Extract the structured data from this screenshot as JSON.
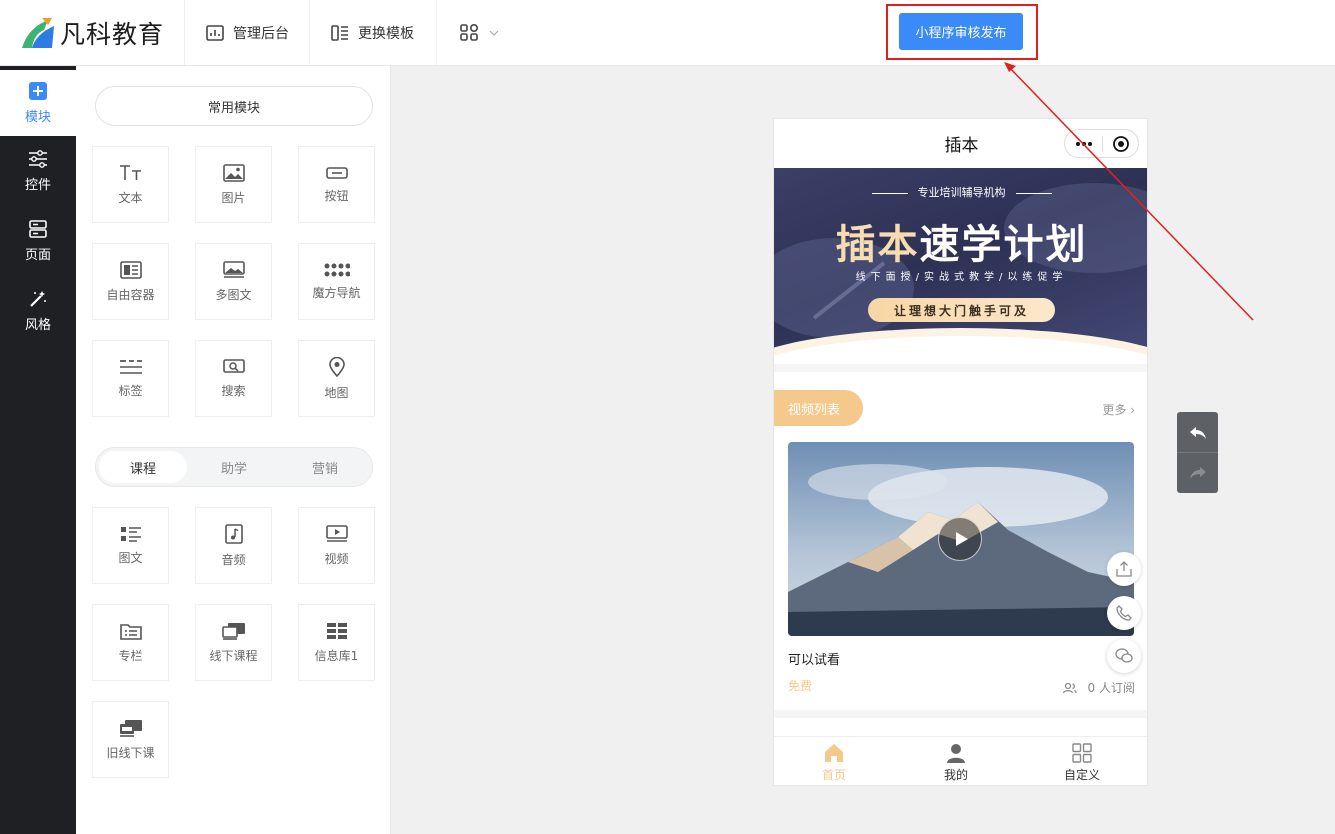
{
  "app": {
    "brand_name": "凡科教育",
    "brand_colors": {
      "blue": "#2f7be5",
      "green": "#3cb371",
      "orange": "#f39b2b"
    }
  },
  "topbar": {
    "nav": [
      {
        "label": "管理后台",
        "icon": "chart-icon"
      },
      {
        "label": "更换模板",
        "icon": "template-icon"
      },
      {
        "label": "",
        "icon": "apps-grid-icon"
      }
    ],
    "publish_label": "小程序审核发布",
    "accent": "#3a8af7",
    "highlight_color": "#e02020"
  },
  "rail": {
    "items": [
      {
        "label": "模块",
        "icon": "plus-square-icon",
        "active": true
      },
      {
        "label": "控件",
        "icon": "sliders-icon"
      },
      {
        "label": "页面",
        "icon": "page-icon"
      },
      {
        "label": "风格",
        "icon": "magic-wand-icon"
      }
    ]
  },
  "panel": {
    "common_label": "常用模块",
    "common_modules": [
      {
        "label": "文本",
        "icon": "text-icon"
      },
      {
        "label": "图片",
        "icon": "image-icon"
      },
      {
        "label": "按钮",
        "icon": "button-icon"
      },
      {
        "label": "自由容器",
        "icon": "container-icon"
      },
      {
        "label": "多图文",
        "icon": "multi-image-icon"
      },
      {
        "label": "魔方导航",
        "icon": "dots-grid-icon"
      },
      {
        "label": "标签",
        "icon": "tabs-icon"
      },
      {
        "label": "搜索",
        "icon": "search-icon"
      },
      {
        "label": "地图",
        "icon": "map-pin-icon"
      }
    ],
    "segments": [
      "课程",
      "助学",
      "营销"
    ],
    "active_segment": "课程",
    "course_modules": [
      {
        "label": "图文",
        "icon": "list-icon"
      },
      {
        "label": "音频",
        "icon": "audio-icon"
      },
      {
        "label": "视频",
        "icon": "video-icon"
      },
      {
        "label": "专栏",
        "icon": "folder-icon"
      },
      {
        "label": "线下课程",
        "icon": "offline-course-icon"
      },
      {
        "label": "信息库1",
        "icon": "info-grid-icon"
      },
      {
        "label": "旧线下课",
        "icon": "old-offline-icon"
      }
    ]
  },
  "phone": {
    "title": "插本",
    "banner": {
      "subtitle": "专业培训辅导机构",
      "title_gold": "插本",
      "title_white": "速学计划",
      "tagline": "线下面授/实战式教学/以练促学",
      "pill": "让理想大门触手可及"
    },
    "section": {
      "tag": "视频列表",
      "more": "更多",
      "video": {
        "title": "可以试看",
        "price": "免费",
        "subs": "0 人订阅"
      }
    },
    "tabbar": [
      {
        "label": "首页",
        "icon": "home-icon",
        "active": true,
        "color": "#f5c98c"
      },
      {
        "label": "我的",
        "icon": "user-icon"
      },
      {
        "label": "自定义",
        "icon": "grid-icon"
      }
    ],
    "floating": [
      "share-icon",
      "phone-icon",
      "wechat-icon"
    ]
  },
  "history": {
    "undo": "undo-icon",
    "redo": "redo-icon"
  }
}
